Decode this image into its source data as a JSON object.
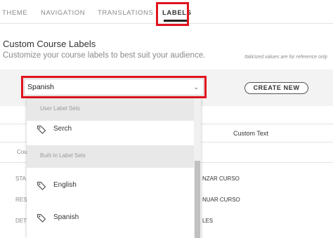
{
  "tabs": [
    {
      "label": "THEME"
    },
    {
      "label": "NAVIGATION"
    },
    {
      "label": "TRANSLATIONS"
    },
    {
      "label": "LABELS"
    }
  ],
  "section": {
    "title": "Custom Course Labels",
    "subtitle": "Customize your course labels to best suit your audience.",
    "note": "Italicized values are for reference only"
  },
  "label_set_select": {
    "value": "Spanish"
  },
  "create_new_label": "CREATE NEW",
  "table": {
    "header_custom_text": "Custom Text",
    "col_course_partial": "Cou",
    "rows": [
      {
        "key_partial": "STA",
        "value_partial": "NZAR CURSO"
      },
      {
        "key_partial": "RES",
        "value_partial": "NUAR CURSO"
      },
      {
        "key_partial": "DET",
        "value_partial": "LES"
      }
    ]
  },
  "dropdown": {
    "user_group_label": "User Label Sets",
    "built_in_group_label": "Built-In Label Sets",
    "user_items": [
      {
        "label": "Serch"
      }
    ],
    "built_in_items": [
      {
        "label": "English"
      },
      {
        "label": "Spanish"
      }
    ]
  },
  "colors": {
    "highlight": "#e0141e",
    "panel": "#f3f3f3"
  }
}
